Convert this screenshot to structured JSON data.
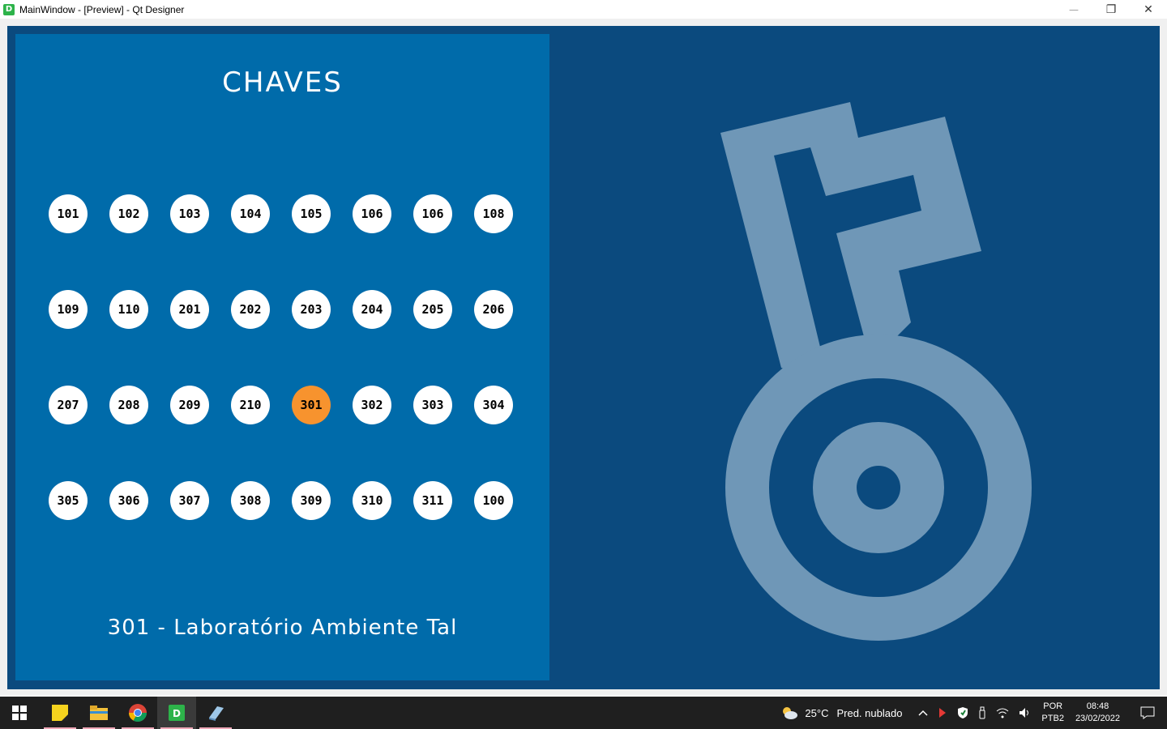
{
  "window": {
    "title": "MainWindow - [Preview] - Qt Designer",
    "app_icon_letter": "D",
    "minimize": "—",
    "restore": "❐",
    "close": "✕"
  },
  "panel": {
    "title": "CHAVES",
    "selected_key": "301",
    "selected_info": "301 - Laboratório Ambiente Tal"
  },
  "keys": [
    "101",
    "102",
    "103",
    "104",
    "105",
    "106",
    "106",
    "108",
    "109",
    "110",
    "201",
    "202",
    "203",
    "204",
    "205",
    "206",
    "207",
    "208",
    "209",
    "210",
    "301",
    "302",
    "303",
    "304",
    "305",
    "306",
    "307",
    "308",
    "309",
    "310",
    "311",
    "100"
  ],
  "colors": {
    "background": "#0b4a7e",
    "panel": "#006baa",
    "key_button": "#ffffff",
    "key_selected": "#f7932e",
    "key_art": "#6f97b7"
  },
  "taskbar": {
    "weather_temp": "25°C",
    "weather_text": "Pred. nublado",
    "lang_top": "POR",
    "lang_bottom": "PTB2",
    "time": "08:48",
    "date": "23/02/2022"
  }
}
